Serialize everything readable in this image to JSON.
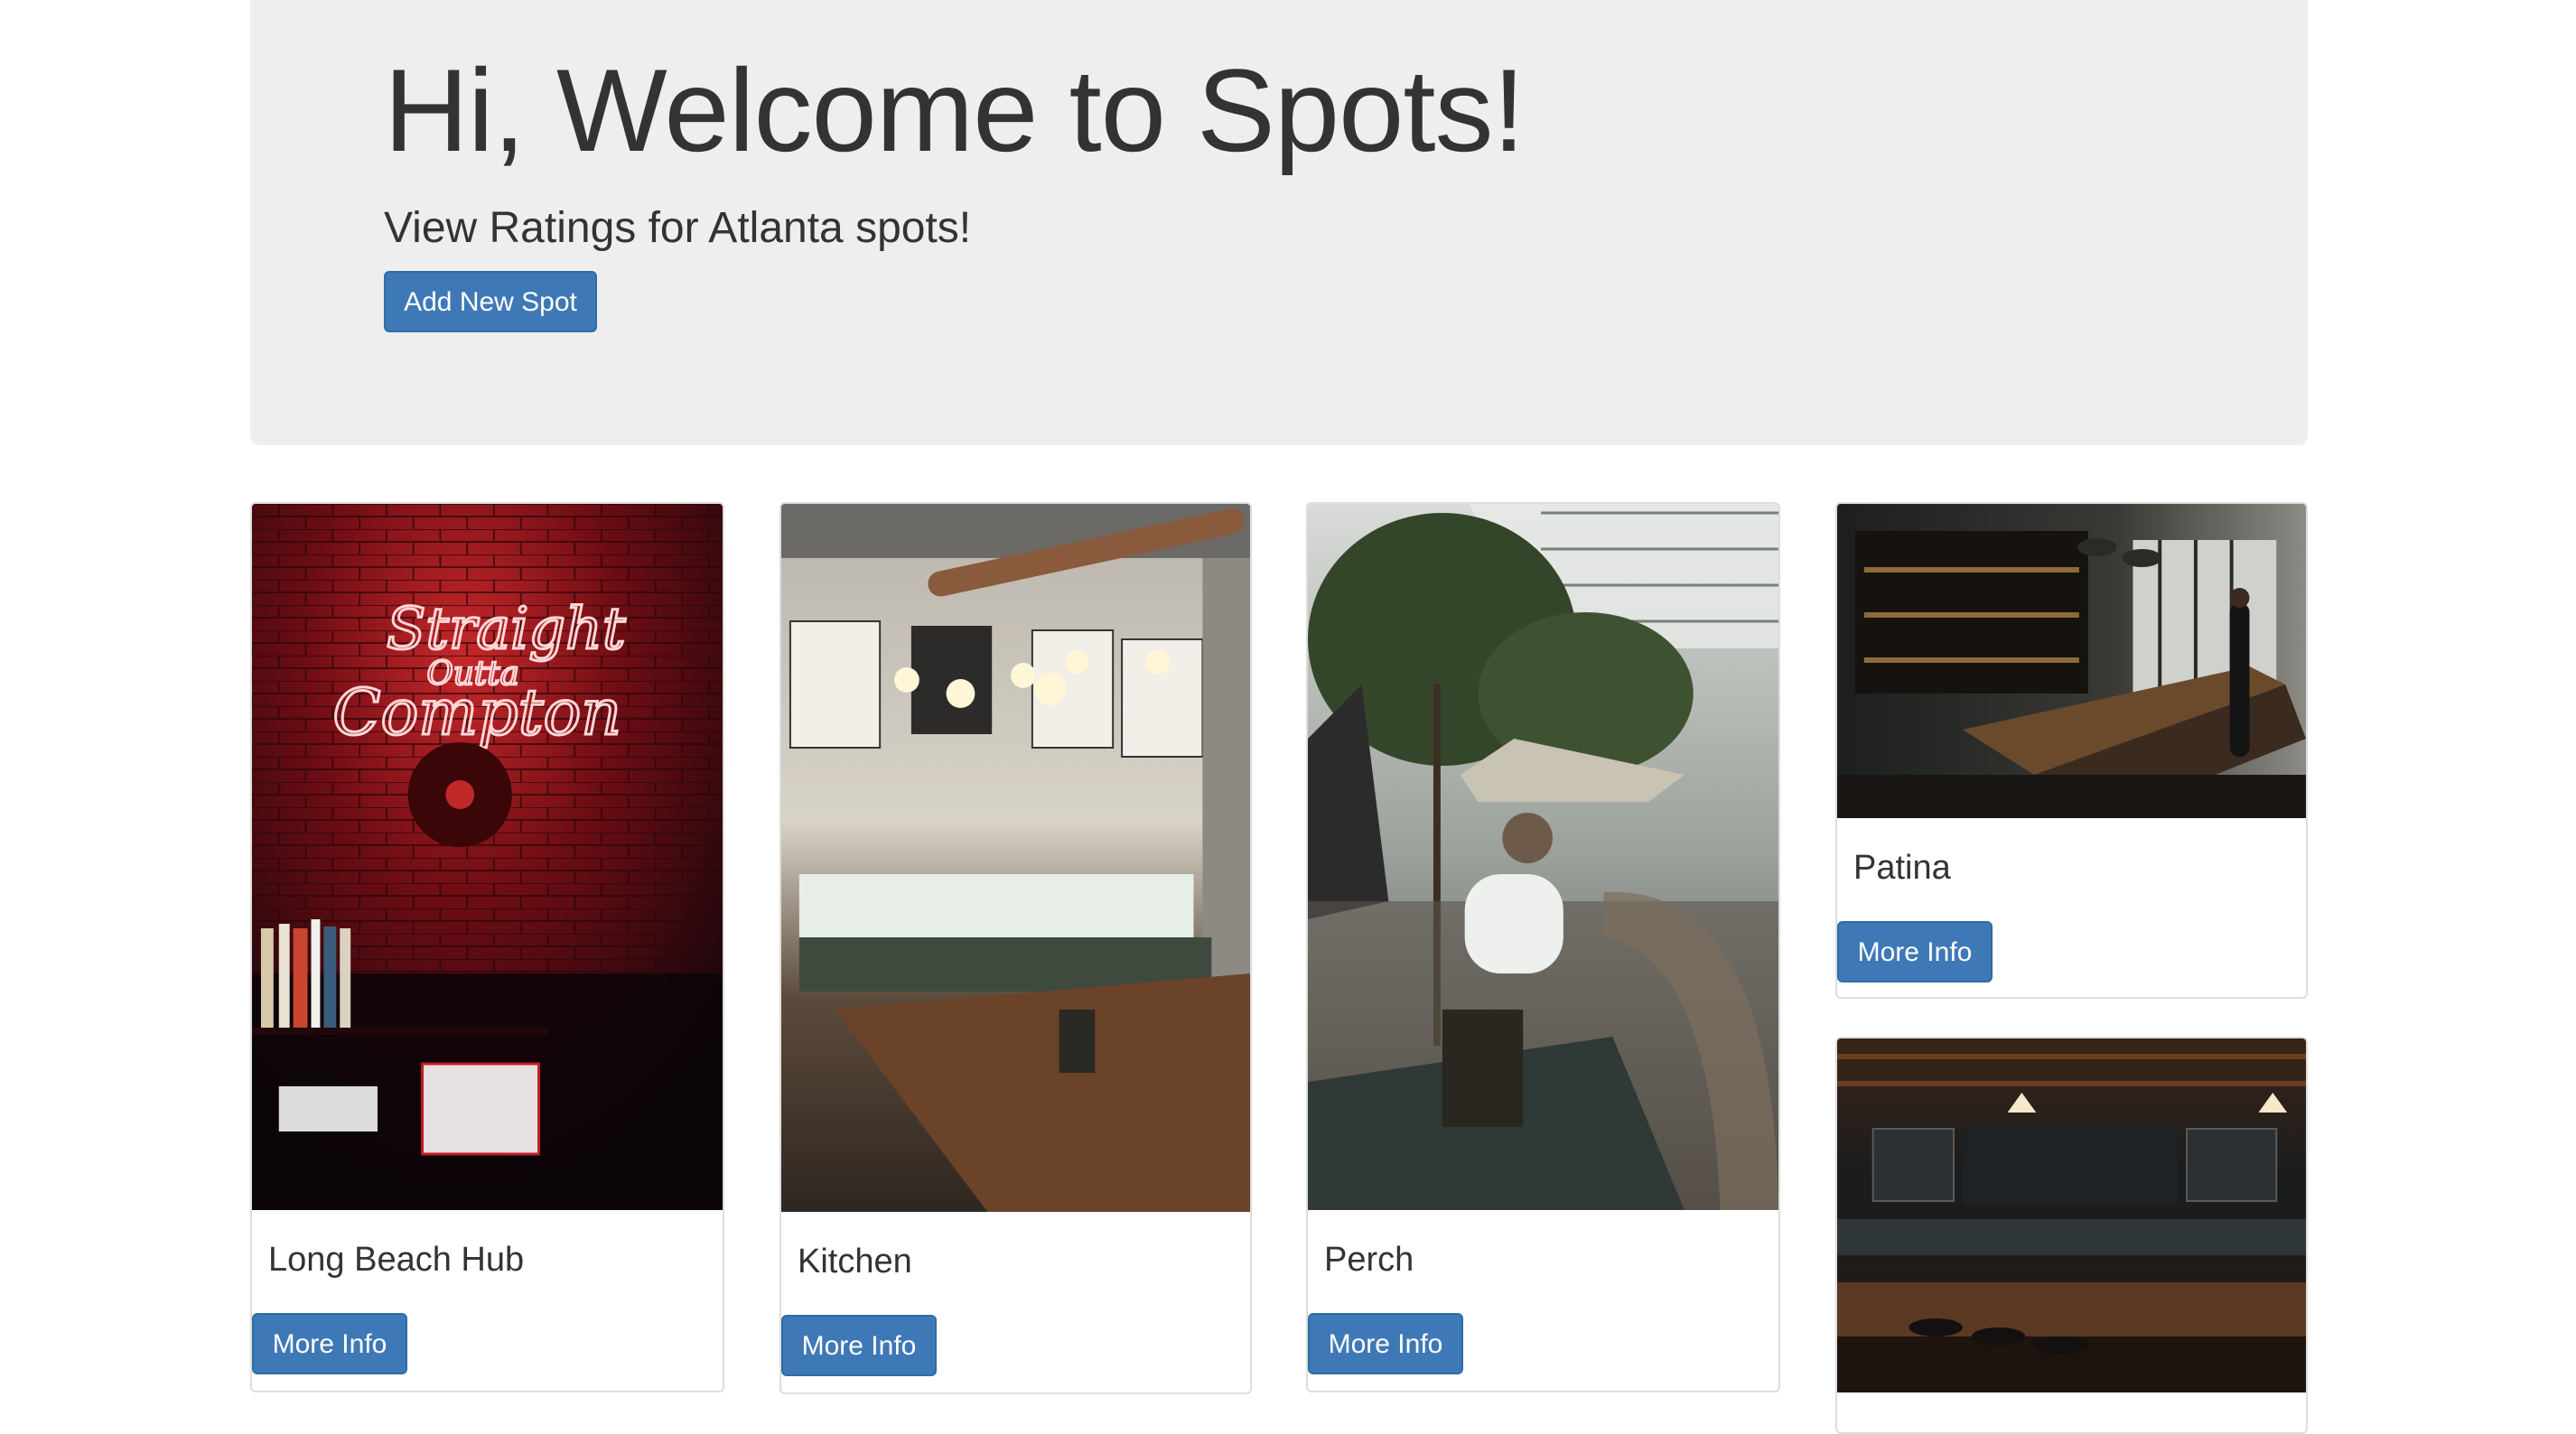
{
  "jumbotron": {
    "title": "Hi, Welcome to Spots!",
    "subtitle": "View Ratings for Atlanta spots!",
    "add_button_label": "Add New Spot"
  },
  "spots": [
    {
      "name": "Long Beach Hub",
      "button_label": "More Info",
      "photo": "neon-sign-brick-wall-photo",
      "neon_text": [
        "Straight",
        "Outta",
        "Compton"
      ]
    },
    {
      "name": "Kitchen",
      "button_label": "More Info",
      "photo": "cafe-interior-photo"
    },
    {
      "name": "Perch",
      "button_label": "More Info",
      "photo": "outdoor-patio-photo"
    },
    {
      "name": "Patina",
      "button_label": "More Info",
      "photo": "bar-interior-photo"
    },
    {
      "name": "",
      "button_label": "",
      "photo": "pub-bar-photo"
    }
  ],
  "colors": {
    "jumbotron_bg": "#eeeeee",
    "primary_button": "#3f78b6",
    "text": "#333333"
  }
}
